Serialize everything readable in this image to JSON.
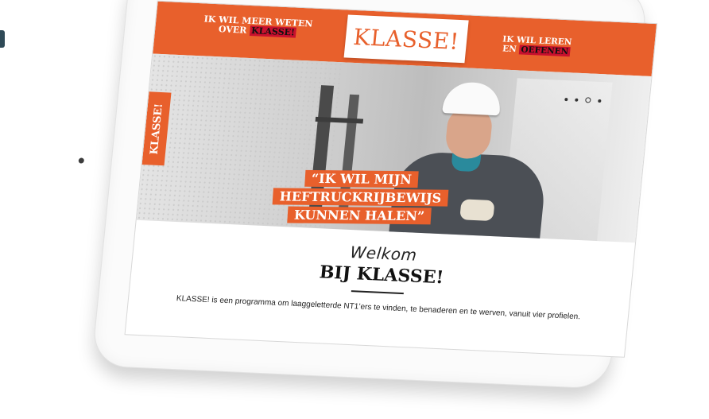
{
  "nav": {
    "left_line1": "IK WIL MEER WETEN",
    "left_prefix": "OVER ",
    "left_highlight": "KLASSE!",
    "right_line1": "IK WIL LEREN",
    "right_prefix": "EN ",
    "right_highlight": "OEFENEN"
  },
  "logo": {
    "text": "KLASSE!"
  },
  "hero": {
    "side_tab": "KLASSE!",
    "quote_lines": [
      "“IK WIL MIJN",
      "HEFTRUCKRIJBEWIJS",
      "KUNNEN HALEN”"
    ],
    "slider_active_index": 2,
    "slider_count": 4
  },
  "welcome": {
    "script": "Welkom",
    "title": "BIJ KLASSE!",
    "intro": "KLASSE! is een programma om laaggeletterde NT1’ers te vinden, te benaderen en te werven, vanuit vier profielen."
  },
  "colors": {
    "accent": "#e8602c",
    "highlight": "#c8102e"
  },
  "icons": [
    "slider-dot-icon",
    "camera-icon"
  ]
}
